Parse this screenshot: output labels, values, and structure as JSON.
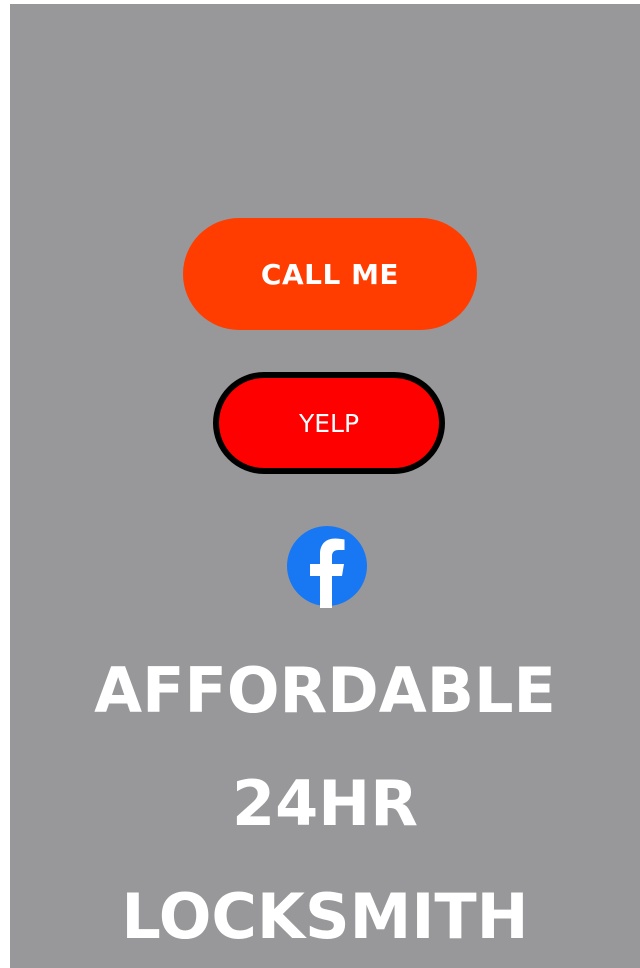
{
  "buttons": {
    "call_label": "CALL ME",
    "yelp_label": "YELP"
  },
  "social": {
    "facebook_icon": "facebook-icon"
  },
  "headline": {
    "line1": "AFFORDABLE",
    "line2": "24HR",
    "line3": "LOCKSMITH"
  },
  "colors": {
    "background": "#98989a",
    "call_button": "#ff3d00",
    "yelp_button": "#fe0000",
    "yelp_border": "#000000",
    "facebook_blue": "#1877f2",
    "text": "#ffffff"
  }
}
